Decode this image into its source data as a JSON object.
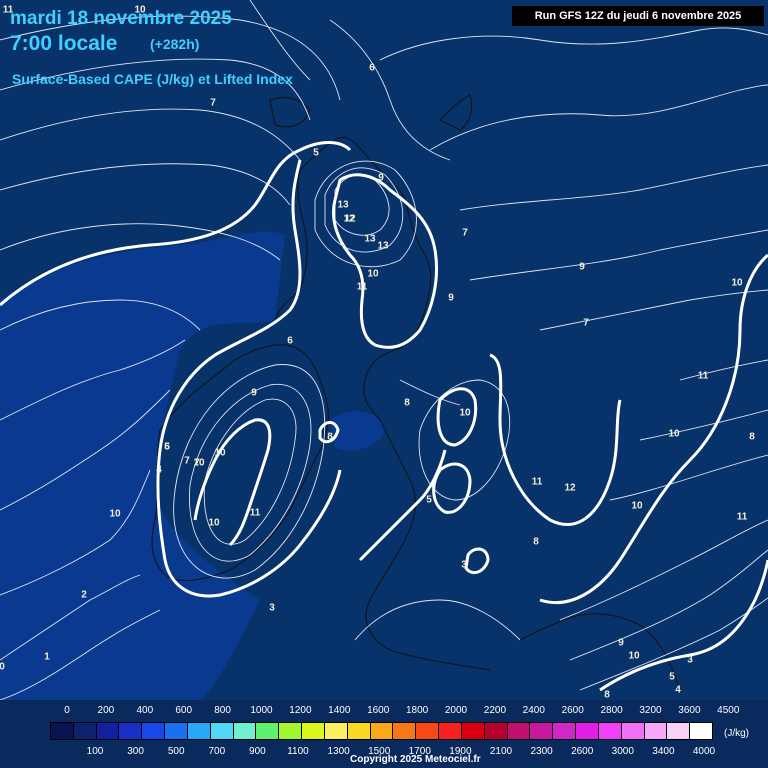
{
  "header": {
    "date": "mardi 18 novembre 2025",
    "time": "7:00 locale",
    "lead": "(+282h)",
    "product": "Surface-Based CAPE (J/kg) et Lifted Index",
    "run": "Run GFS 12Z du jeudi 6 novembre 2025"
  },
  "contour_labels": [
    "11",
    "10",
    "6",
    "7",
    "5",
    "9",
    "13",
    "12",
    "13",
    "12",
    "13",
    "7",
    "9",
    "10",
    "11",
    "9",
    "8",
    "10",
    "7",
    "6",
    "11",
    "9",
    "8",
    "10",
    "7",
    "5",
    "4",
    "10",
    "7",
    "6",
    "5",
    "10",
    "3",
    "10",
    "11",
    "11",
    "12",
    "10",
    "8",
    "11",
    "10",
    "8",
    "2",
    "1",
    "0",
    "0",
    "3",
    "10",
    "8",
    "9",
    "10",
    "5",
    "4",
    "3"
  ],
  "colorbar": {
    "unit": "(J/kg)",
    "top_ticks": [
      "0",
      "200",
      "400",
      "600",
      "800",
      "1000",
      "1200",
      "1400",
      "1600",
      "1800",
      "2000",
      "2200",
      "2400",
      "2600",
      "2800",
      "3200",
      "3600",
      "4500"
    ],
    "bottom_ticks": [
      "100",
      "300",
      "500",
      "700",
      "900",
      "1100",
      "1300",
      "1500",
      "1700",
      "1900",
      "2100",
      "2300",
      "2600",
      "3000",
      "3400",
      "4000"
    ],
    "colors": [
      "#0a1450",
      "#0c2270",
      "#1020a0",
      "#1830c8",
      "#1848e8",
      "#1a70f0",
      "#28a8f8",
      "#50d8f8",
      "#70f0d0",
      "#60f070",
      "#a0f830",
      "#d8f820",
      "#f8f060",
      "#f8d820",
      "#f8a818",
      "#f87818",
      "#f84818",
      "#f82020",
      "#d80010",
      "#b80030",
      "#c01070",
      "#c818a0",
      "#d028c8",
      "#e020e8",
      "#f040f8",
      "#f070f8",
      "#f8a8f8",
      "#f8d0f8",
      "#ffffff"
    ]
  },
  "copyright": "Copyright 2025 Meteociel.fr"
}
